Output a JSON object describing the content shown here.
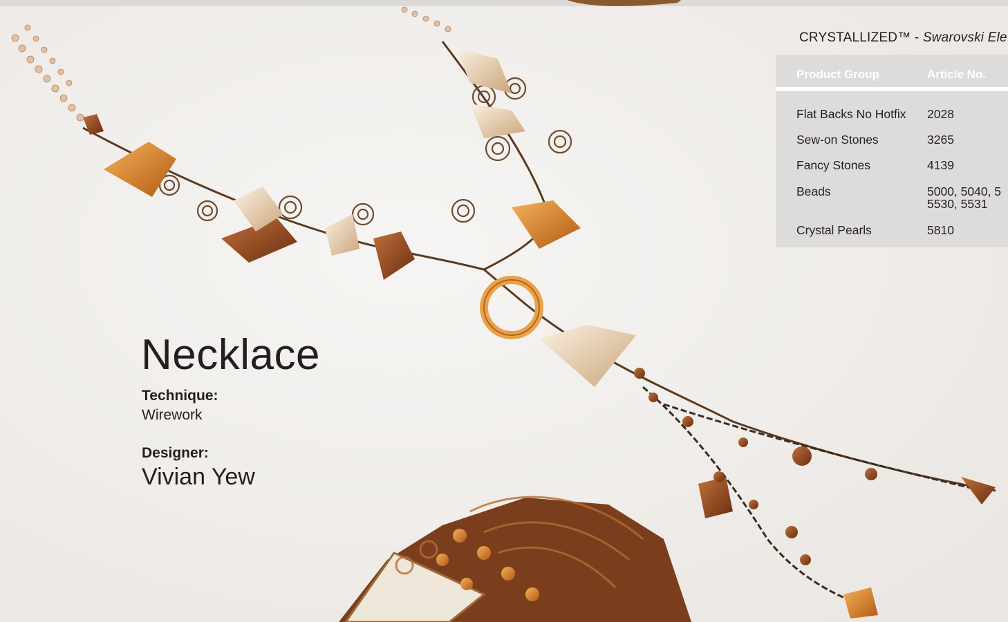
{
  "spec": {
    "title_prefix": "CRYSTALLIZED™ - ",
    "title_italic": "Swarovski Ele",
    "columns": [
      "Product Group",
      "Article No."
    ],
    "rows": [
      {
        "group": "Flat Backs No Hotfix",
        "article": "2028"
      },
      {
        "group": "Sew-on Stones",
        "article": "3265"
      },
      {
        "group": "Fancy Stones",
        "article": "4139"
      },
      {
        "group": "Beads",
        "article": "5000, 5040, 5\n5530, 5531"
      },
      {
        "group": "Crystal Pearls",
        "article": "5810"
      }
    ]
  },
  "piece": {
    "title": "Necklace",
    "technique_label": "Technique:",
    "technique": "Wirework",
    "designer_label": "Designer:",
    "designer": "Vivian Yew"
  },
  "palette": {
    "background": "#f1efed",
    "panel": "#dedcda",
    "copper": "#8a4a23",
    "amber": "#d9841e",
    "champagne": "#e9cfae",
    "wire": "#5a3a22"
  }
}
